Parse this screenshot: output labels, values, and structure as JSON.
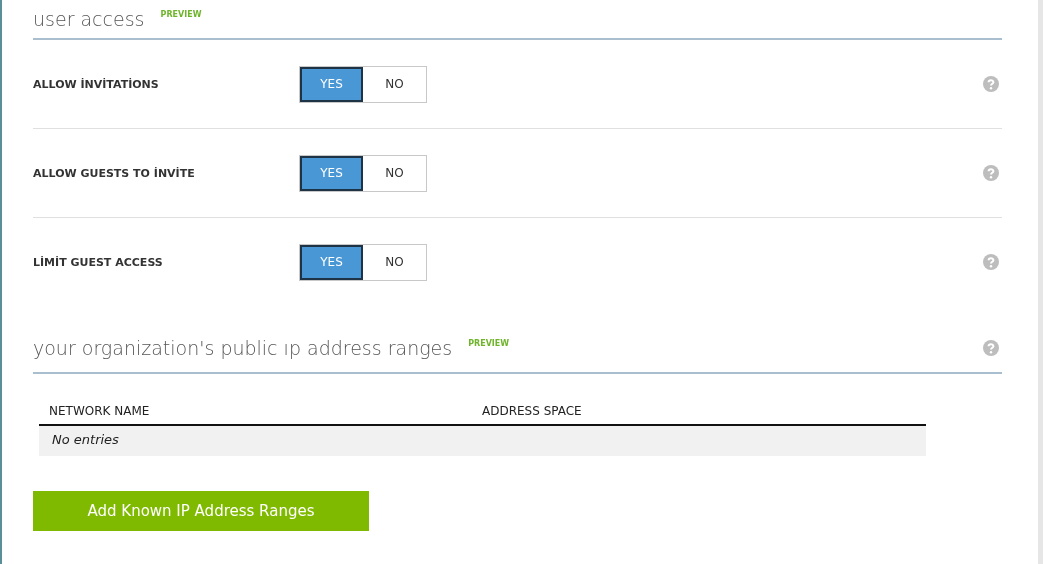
{
  "sections": [
    {
      "title": "user access",
      "badge": "PREVIEW",
      "help": false,
      "settings": [
        {
          "label": "ALLOW İNVİTATİONS",
          "options": [
            {
              "label": "YES",
              "selected": true
            },
            {
              "label": "NO",
              "selected": false
            }
          ]
        },
        {
          "label": "ALLOW GUESTS TO İNVİTE",
          "options": [
            {
              "label": "YES",
              "selected": true
            },
            {
              "label": "NO",
              "selected": false
            }
          ]
        },
        {
          "label": "LİMİT GUEST ACCESS",
          "options": [
            {
              "label": "YES",
              "selected": true
            },
            {
              "label": "NO",
              "selected": false
            }
          ]
        }
      ]
    },
    {
      "title": "your organization's public ıp address ranges",
      "badge": "PREVIEW",
      "help": true,
      "table": {
        "columns": [
          "NETWORK NAME",
          "ADDRESS SPACE"
        ],
        "empty_text": "No entries"
      },
      "button": "Add Known IP Address Ranges"
    }
  ]
}
